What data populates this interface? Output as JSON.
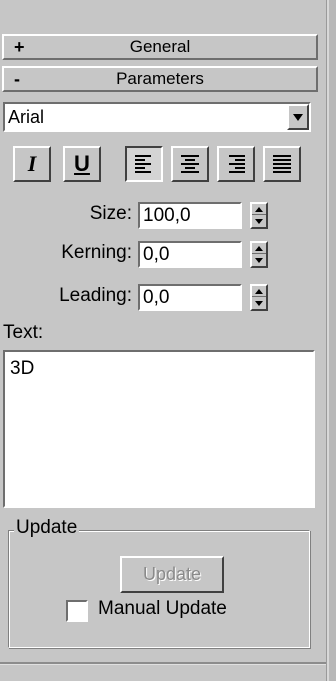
{
  "rollouts": {
    "general": {
      "sign": "+",
      "title": "General"
    },
    "parameters": {
      "sign": "-",
      "title": "Parameters"
    }
  },
  "font": {
    "selected": "Arial"
  },
  "style_buttons": {
    "italic": "I",
    "underline": "U"
  },
  "alignment": {
    "options": [
      "align-left",
      "align-center",
      "align-right",
      "justify"
    ],
    "selected": "align-left"
  },
  "fields": {
    "size": {
      "label": "Size:",
      "value": "100,0"
    },
    "kerning": {
      "label": "Kerning:",
      "value": "0,0"
    },
    "leading": {
      "label": "Leading:",
      "value": "0,0"
    }
  },
  "text": {
    "label": "Text:",
    "value": "3D"
  },
  "update_group": {
    "title": "Update",
    "button_label": "Update",
    "button_enabled": false,
    "manual_update_label": "Manual Update",
    "manual_update_checked": false
  }
}
